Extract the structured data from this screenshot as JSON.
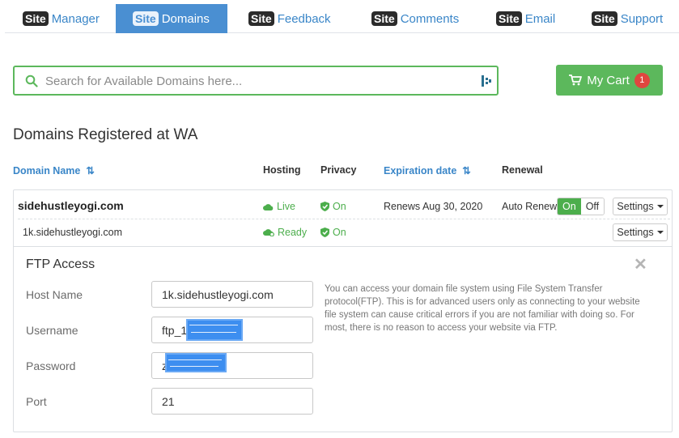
{
  "nav": {
    "badge_text": "Site",
    "tabs": [
      {
        "label": "Manager",
        "active": false
      },
      {
        "label": "Domains",
        "active": true
      },
      {
        "label": "Feedback",
        "active": false
      },
      {
        "label": "Comments",
        "active": false
      },
      {
        "label": "Email",
        "active": false
      },
      {
        "label": "Support",
        "active": false
      }
    ]
  },
  "search": {
    "placeholder": "Search for Available Domains here...",
    "value": ""
  },
  "cart": {
    "label": "My Cart",
    "count": "1"
  },
  "page_title": "Domains Registered at WA",
  "table": {
    "headers": {
      "domain_name": "Domain Name",
      "hosting": "Hosting",
      "privacy": "Privacy",
      "expiration_date": "Expiration date",
      "renewal": "Renewal"
    },
    "rows": [
      {
        "domain": "sidehustleyogi.com",
        "hosting": "Live",
        "privacy": "On",
        "expiration": "Renews Aug 30, 2020",
        "renewal_label": "Auto Renew",
        "toggle_on": "On",
        "toggle_off": "Off",
        "settings": "Settings"
      },
      {
        "domain": "1k.sidehustleyogi.com",
        "hosting": "Ready",
        "privacy": "On",
        "settings": "Settings"
      }
    ]
  },
  "ftp": {
    "title": "FTP Access",
    "fields": {
      "host_label": "Host Name",
      "host_value": "1k.sidehustleyogi.com",
      "username_label": "Username",
      "username_value": "ftp_1",
      "password_label": "Password",
      "password_value": "z",
      "port_label": "Port",
      "port_value": "21"
    },
    "help_text": "You can access your domain file system using File System Transfer protocol(FTP). This is for advanced users only as connecting to your website file system can cause critical errors if you are not familiar with doing so. For most, there is no reason to access your website via FTP."
  },
  "colors": {
    "accent_blue": "#4a8fd2",
    "link_blue": "#3a86c8",
    "success_green": "#5cb85c",
    "badge_red": "#e0463f"
  }
}
